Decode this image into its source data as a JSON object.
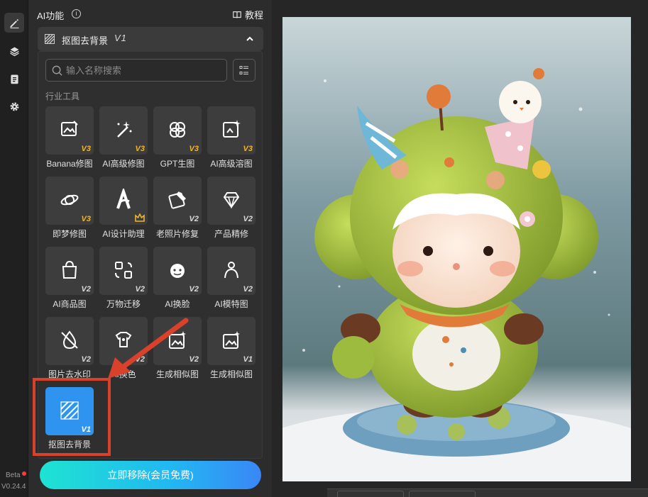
{
  "sidebar": {
    "items": [
      {
        "icon": "pencil-icon",
        "active": true
      },
      {
        "icon": "layers-icon",
        "active": false
      },
      {
        "icon": "clipboard-icon",
        "active": false
      },
      {
        "icon": "gear-icon",
        "active": false
      }
    ],
    "beta_label": "Beta",
    "version": "V0.24.4"
  },
  "panel": {
    "title": "AI功能",
    "info_icon": "i",
    "tutorial_label": "教程",
    "current_function": {
      "label": "抠图去背景",
      "version": "V1",
      "icon": "stripes-icon"
    }
  },
  "dropdown": {
    "search_placeholder": "输入名称搜索",
    "search_value": "",
    "section_label": "行业工具",
    "tools": [
      {
        "label": "Banana修图",
        "version": "V3",
        "gold": true,
        "icon": "image-edit-icon"
      },
      {
        "label": "AI高级修图",
        "version": "V3",
        "gold": true,
        "icon": "magic-wand-icon"
      },
      {
        "label": "GPT生图",
        "version": "V3",
        "gold": true,
        "icon": "gpt-knot-icon"
      },
      {
        "label": "AI高级溶图",
        "version": "V3",
        "gold": true,
        "icon": "image-sparkle-icon"
      },
      {
        "label": "即梦修图",
        "version": "V3",
        "gold": true,
        "icon": "planet-icon"
      },
      {
        "label": "AI设计助理",
        "version": "",
        "gold": false,
        "icon": "design-a-icon",
        "crown": true
      },
      {
        "label": "老照片修复",
        "version": "V2",
        "gold": false,
        "icon": "photo-repair-icon"
      },
      {
        "label": "产品精修",
        "version": "V2",
        "gold": false,
        "icon": "diamond-icon"
      },
      {
        "label": "AI商品图",
        "version": "V2",
        "gold": false,
        "icon": "shopping-bag-icon"
      },
      {
        "label": "万物迁移",
        "version": "V2",
        "gold": false,
        "icon": "transfer-icon"
      },
      {
        "label": "AI换脸",
        "version": "V2",
        "gold": false,
        "icon": "face-swap-icon"
      },
      {
        "label": "AI模特图",
        "version": "V2",
        "gold": false,
        "icon": "model-icon"
      },
      {
        "label": "图片去水印",
        "version": "V2",
        "gold": false,
        "icon": "watermark-remove-icon"
      },
      {
        "label": "AI换色",
        "version": "V2",
        "gold": false,
        "icon": "palette-shirt-icon"
      },
      {
        "label": "生成相似图",
        "version": "V2",
        "gold": false,
        "icon": "similar-image-icon"
      },
      {
        "label": "生成相似图",
        "version": "V1",
        "gold": false,
        "icon": "similar-image-icon"
      },
      {
        "label": "抠图去背景",
        "version": "V1",
        "gold": false,
        "icon": "stripes-icon",
        "active": true
      }
    ]
  },
  "cta_label": "立即移除(会员免费)",
  "colors": {
    "accent_blue": "#2f93f0",
    "gold_badge": "#f0b429",
    "highlight_red": "#d9412a",
    "cta_start": "#1ee3d2",
    "cta_end": "#3a86f7"
  }
}
